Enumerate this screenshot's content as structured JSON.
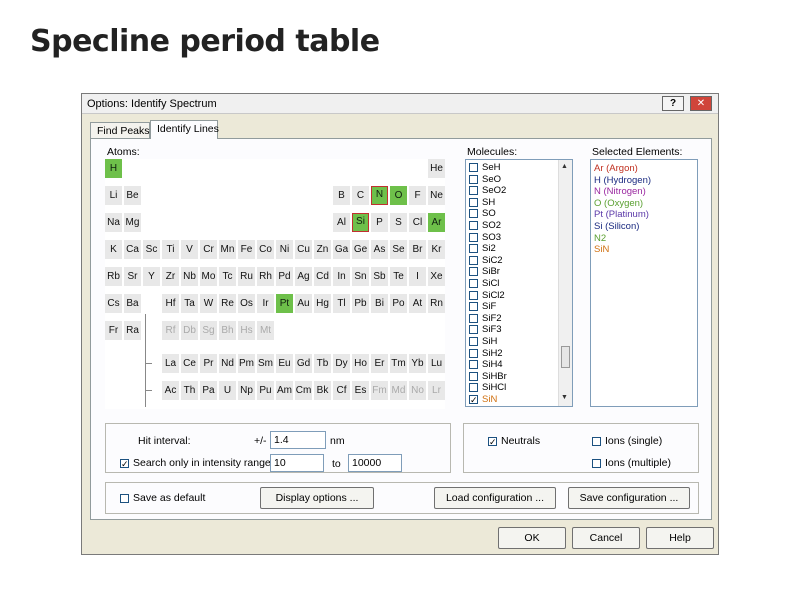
{
  "page_title": "Specline period table",
  "window": {
    "title": "Options: Identify Spectrum",
    "help_glyph": "?",
    "close_glyph": "✕"
  },
  "tabs": [
    {
      "label": "Find Peaks"
    },
    {
      "label": "Identify Lines",
      "active": true
    }
  ],
  "atoms": {
    "label": "Atoms:",
    "elements": [
      {
        "s": "H",
        "r": 0,
        "c": 0,
        "g": true
      },
      {
        "s": "He",
        "r": 0,
        "c": 17
      },
      {
        "s": "Li",
        "r": 1,
        "c": 0
      },
      {
        "s": "Be",
        "r": 1,
        "c": 1
      },
      {
        "s": "B",
        "r": 1,
        "c": 12
      },
      {
        "s": "C",
        "r": 1,
        "c": 13
      },
      {
        "s": "N",
        "r": 1,
        "c": 14,
        "g": true,
        "x": true
      },
      {
        "s": "O",
        "r": 1,
        "c": 15,
        "g": true
      },
      {
        "s": "F",
        "r": 1,
        "c": 16
      },
      {
        "s": "Ne",
        "r": 1,
        "c": 17
      },
      {
        "s": "Na",
        "r": 2,
        "c": 0
      },
      {
        "s": "Mg",
        "r": 2,
        "c": 1
      },
      {
        "s": "Al",
        "r": 2,
        "c": 12
      },
      {
        "s": "Si",
        "r": 2,
        "c": 13,
        "g": true,
        "x": true
      },
      {
        "s": "P",
        "r": 2,
        "c": 14
      },
      {
        "s": "S",
        "r": 2,
        "c": 15
      },
      {
        "s": "Cl",
        "r": 2,
        "c": 16
      },
      {
        "s": "Ar",
        "r": 2,
        "c": 17,
        "g": true
      },
      {
        "s": "K",
        "r": 3,
        "c": 0
      },
      {
        "s": "Ca",
        "r": 3,
        "c": 1
      },
      {
        "s": "Sc",
        "r": 3,
        "c": 2
      },
      {
        "s": "Ti",
        "r": 3,
        "c": 3
      },
      {
        "s": "V",
        "r": 3,
        "c": 4
      },
      {
        "s": "Cr",
        "r": 3,
        "c": 5
      },
      {
        "s": "Mn",
        "r": 3,
        "c": 6
      },
      {
        "s": "Fe",
        "r": 3,
        "c": 7
      },
      {
        "s": "Co",
        "r": 3,
        "c": 8
      },
      {
        "s": "Ni",
        "r": 3,
        "c": 9
      },
      {
        "s": "Cu",
        "r": 3,
        "c": 10
      },
      {
        "s": "Zn",
        "r": 3,
        "c": 11
      },
      {
        "s": "Ga",
        "r": 3,
        "c": 12
      },
      {
        "s": "Ge",
        "r": 3,
        "c": 13
      },
      {
        "s": "As",
        "r": 3,
        "c": 14
      },
      {
        "s": "Se",
        "r": 3,
        "c": 15
      },
      {
        "s": "Br",
        "r": 3,
        "c": 16
      },
      {
        "s": "Kr",
        "r": 3,
        "c": 17
      },
      {
        "s": "Rb",
        "r": 4,
        "c": 0
      },
      {
        "s": "Sr",
        "r": 4,
        "c": 1
      },
      {
        "s": "Y",
        "r": 4,
        "c": 2
      },
      {
        "s": "Zr",
        "r": 4,
        "c": 3
      },
      {
        "s": "Nb",
        "r": 4,
        "c": 4
      },
      {
        "s": "Mo",
        "r": 4,
        "c": 5
      },
      {
        "s": "Tc",
        "r": 4,
        "c": 6
      },
      {
        "s": "Ru",
        "r": 4,
        "c": 7
      },
      {
        "s": "Rh",
        "r": 4,
        "c": 8
      },
      {
        "s": "Pd",
        "r": 4,
        "c": 9
      },
      {
        "s": "Ag",
        "r": 4,
        "c": 10
      },
      {
        "s": "Cd",
        "r": 4,
        "c": 11
      },
      {
        "s": "In",
        "r": 4,
        "c": 12
      },
      {
        "s": "Sn",
        "r": 4,
        "c": 13
      },
      {
        "s": "Sb",
        "r": 4,
        "c": 14
      },
      {
        "s": "Te",
        "r": 4,
        "c": 15
      },
      {
        "s": "I",
        "r": 4,
        "c": 16
      },
      {
        "s": "Xe",
        "r": 4,
        "c": 17
      },
      {
        "s": "Cs",
        "r": 5,
        "c": 0
      },
      {
        "s": "Ba",
        "r": 5,
        "c": 1
      },
      {
        "s": "Hf",
        "r": 5,
        "c": 3
      },
      {
        "s": "Ta",
        "r": 5,
        "c": 4
      },
      {
        "s": "W",
        "r": 5,
        "c": 5
      },
      {
        "s": "Re",
        "r": 5,
        "c": 6
      },
      {
        "s": "Os",
        "r": 5,
        "c": 7
      },
      {
        "s": "Ir",
        "r": 5,
        "c": 8
      },
      {
        "s": "Pt",
        "r": 5,
        "c": 9,
        "g": true
      },
      {
        "s": "Au",
        "r": 5,
        "c": 10
      },
      {
        "s": "Hg",
        "r": 5,
        "c": 11
      },
      {
        "s": "Tl",
        "r": 5,
        "c": 12
      },
      {
        "s": "Pb",
        "r": 5,
        "c": 13
      },
      {
        "s": "Bi",
        "r": 5,
        "c": 14
      },
      {
        "s": "Po",
        "r": 5,
        "c": 15
      },
      {
        "s": "At",
        "r": 5,
        "c": 16
      },
      {
        "s": "Rn",
        "r": 5,
        "c": 17
      },
      {
        "s": "Fr",
        "r": 6,
        "c": 0
      },
      {
        "s": "Ra",
        "r": 6,
        "c": 1
      },
      {
        "s": "Rf",
        "r": 6,
        "c": 3,
        "d": true
      },
      {
        "s": "Db",
        "r": 6,
        "c": 4,
        "d": true
      },
      {
        "s": "Sg",
        "r": 6,
        "c": 5,
        "d": true
      },
      {
        "s": "Bh",
        "r": 6,
        "c": 6,
        "d": true
      },
      {
        "s": "Hs",
        "r": 6,
        "c": 7,
        "d": true
      },
      {
        "s": "Mt",
        "r": 6,
        "c": 8,
        "d": true
      },
      {
        "s": "La",
        "r": 7,
        "c": 3
      },
      {
        "s": "Ce",
        "r": 7,
        "c": 4
      },
      {
        "s": "Pr",
        "r": 7,
        "c": 5
      },
      {
        "s": "Nd",
        "r": 7,
        "c": 6
      },
      {
        "s": "Pm",
        "r": 7,
        "c": 7
      },
      {
        "s": "Sm",
        "r": 7,
        "c": 8
      },
      {
        "s": "Eu",
        "r": 7,
        "c": 9
      },
      {
        "s": "Gd",
        "r": 7,
        "c": 10
      },
      {
        "s": "Tb",
        "r": 7,
        "c": 11
      },
      {
        "s": "Dy",
        "r": 7,
        "c": 12
      },
      {
        "s": "Ho",
        "r": 7,
        "c": 13
      },
      {
        "s": "Er",
        "r": 7,
        "c": 14
      },
      {
        "s": "Tm",
        "r": 7,
        "c": 15
      },
      {
        "s": "Yb",
        "r": 7,
        "c": 16
      },
      {
        "s": "Lu",
        "r": 7,
        "c": 17
      },
      {
        "s": "Ac",
        "r": 8,
        "c": 3
      },
      {
        "s": "Th",
        "r": 8,
        "c": 4
      },
      {
        "s": "Pa",
        "r": 8,
        "c": 5
      },
      {
        "s": "U",
        "r": 8,
        "c": 6
      },
      {
        "s": "Np",
        "r": 8,
        "c": 7
      },
      {
        "s": "Pu",
        "r": 8,
        "c": 8
      },
      {
        "s": "Am",
        "r": 8,
        "c": 9
      },
      {
        "s": "Cm",
        "r": 8,
        "c": 10
      },
      {
        "s": "Bk",
        "r": 8,
        "c": 11
      },
      {
        "s": "Cf",
        "r": 8,
        "c": 12
      },
      {
        "s": "Es",
        "r": 8,
        "c": 13
      },
      {
        "s": "Fm",
        "r": 8,
        "c": 14,
        "d": true
      },
      {
        "s": "Md",
        "r": 8,
        "c": 15,
        "d": true
      },
      {
        "s": "No",
        "r": 8,
        "c": 16,
        "d": true
      },
      {
        "s": "Lr",
        "r": 8,
        "c": 17,
        "d": true
      }
    ]
  },
  "molecules": {
    "label": "Molecules:",
    "items": [
      {
        "name": "SeH",
        "checked": false
      },
      {
        "name": "SeO",
        "checked": false
      },
      {
        "name": "SeO2",
        "checked": false
      },
      {
        "name": "SH",
        "checked": false
      },
      {
        "name": "SO",
        "checked": false
      },
      {
        "name": "SO2",
        "checked": false
      },
      {
        "name": "SO3",
        "checked": false
      },
      {
        "name": "Si2",
        "checked": false
      },
      {
        "name": "SiC2",
        "checked": false
      },
      {
        "name": "SiBr",
        "checked": false
      },
      {
        "name": "SiCl",
        "checked": false
      },
      {
        "name": "SiCl2",
        "checked": false
      },
      {
        "name": "SiF",
        "checked": false
      },
      {
        "name": "SiF2",
        "checked": false
      },
      {
        "name": "SiF3",
        "checked": false
      },
      {
        "name": "SiH",
        "checked": false
      },
      {
        "name": "SiH2",
        "checked": false
      },
      {
        "name": "SiH4",
        "checked": false
      },
      {
        "name": "SiHBr",
        "checked": false
      },
      {
        "name": "SiHCl",
        "checked": false
      },
      {
        "name": "SiN",
        "checked": true,
        "color": "#d07010"
      }
    ],
    "scroll_up": "▲",
    "scroll_down": "▼"
  },
  "selected_elements": {
    "label": "Selected Elements:",
    "items": [
      {
        "name": "Ar (Argon)",
        "color": "#c03020"
      },
      {
        "name": "H (Hydrogen)",
        "color": "#1a2a80"
      },
      {
        "name": "N (Nitrogen)",
        "color": "#9a28a0"
      },
      {
        "name": "O (Oxygen)",
        "color": "#5aa030"
      },
      {
        "name": "Pt (Platinum)",
        "color": "#5a38a8"
      },
      {
        "name": "Si (Silicon)",
        "color": "#1a2a80"
      },
      {
        "name": "N2",
        "color": "#5aa030"
      },
      {
        "name": "SiN",
        "color": "#d07010"
      }
    ]
  },
  "search": {
    "hit_interval_label": "Hit interval:",
    "plusminus": "+/-",
    "hit_interval_value": "1.4",
    "unit": "nm",
    "intensity_label": "Search only in intensity range",
    "intensity_checked": true,
    "range_from": "10",
    "range_to_label": "to",
    "range_to": "10000"
  },
  "species": {
    "neutrals_label": "Neutrals",
    "neutrals_checked": true,
    "ions_single_label": "Ions (single)",
    "ions_single_checked": false,
    "ions_multiple_label": "Ions (multiple)",
    "ions_multiple_checked": false
  },
  "config": {
    "save_default_label": "Save as default",
    "save_default_checked": false,
    "display_options": "Display options ...",
    "load_config": "Load configuration ...",
    "save_config": "Save configuration ..."
  },
  "footer": {
    "ok": "OK",
    "cancel": "Cancel",
    "help": "Help"
  },
  "colors": {
    "element_active": "#6ec04a",
    "element_selected_border": "#c03030"
  }
}
